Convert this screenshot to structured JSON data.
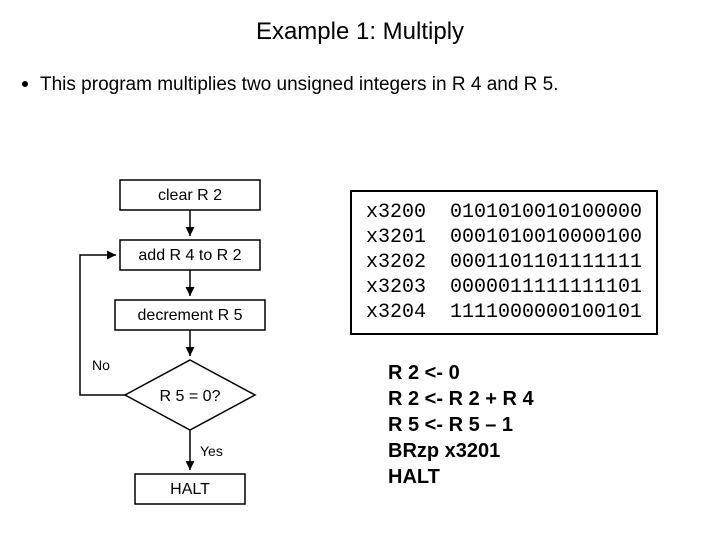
{
  "title": "Example 1: Multiply",
  "subtitle": "This program multiplies two unsigned integers in R 4 and R 5.",
  "flow": {
    "step1": "clear R 2",
    "step2": "add R 4 to R 2",
    "step3": "decrement R 5",
    "decision": "R 5 = 0?",
    "no": "No",
    "yes": "Yes",
    "halt": "HALT"
  },
  "machine_code": [
    {
      "addr": "x3200",
      "bits": "0101010010100000"
    },
    {
      "addr": "x3201",
      "bits": "0001010010000100"
    },
    {
      "addr": "x3202",
      "bits": "0001101101111111"
    },
    {
      "addr": "x3203",
      "bits": "0000011111111101"
    },
    {
      "addr": "x3204",
      "bits": "1111000000100101"
    }
  ],
  "asm": [
    "R 2 <- 0",
    "R 2 <- R 2 + R 4",
    "R 5 <- R 5 – 1",
    "BRzp x3201",
    "HALT"
  ]
}
